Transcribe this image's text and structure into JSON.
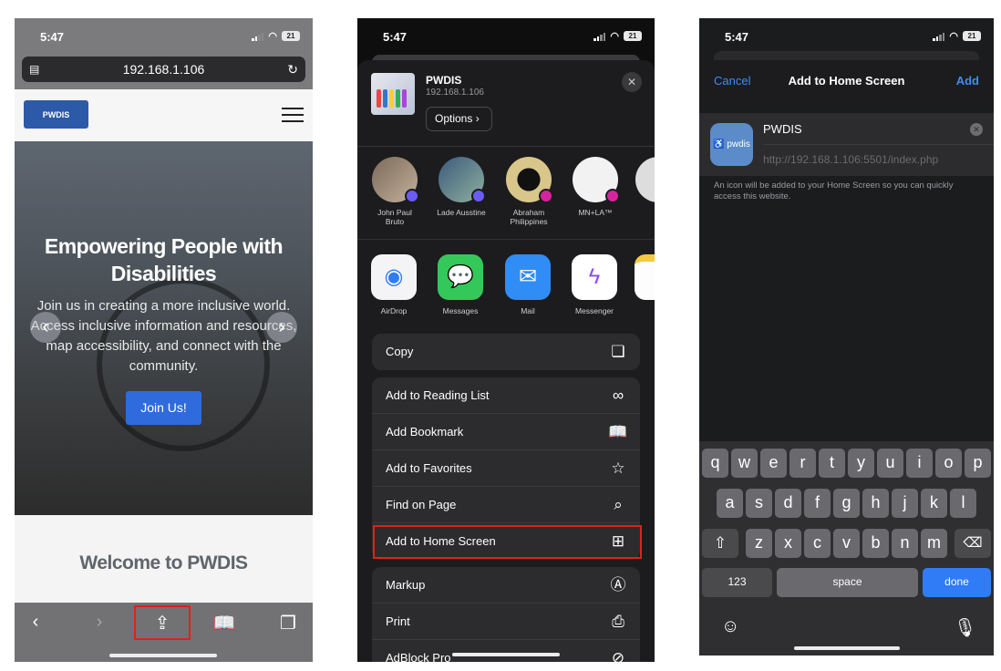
{
  "status": {
    "time": "5:47",
    "battery": "21"
  },
  "safari": {
    "url": "192.168.1.106",
    "logo_text": "PWDIS",
    "hero_title": "Empowering People with Disabilities",
    "hero_text": "Join us in creating a more inclusive world. Access inclusive information and resources, map accessibility, and connect with the community.",
    "join_label": "Join Us!",
    "welcome": "Welcome to PWDIS"
  },
  "share": {
    "site_name": "PWDIS",
    "site_url": "192.168.1.106",
    "options_label": "Options",
    "people": [
      {
        "name": "John Paul Bruto",
        "badge": "messenger"
      },
      {
        "name": "Lade Ausstine",
        "badge": "messenger"
      },
      {
        "name": "Abraham Philippines",
        "badge": "instagram"
      },
      {
        "name": "MN+LA™",
        "badge": "instagram"
      }
    ],
    "apps": [
      "AirDrop",
      "Messages",
      "Mail",
      "Messenger",
      "N"
    ],
    "actions_1": [
      {
        "label": "Copy",
        "icon": "copy-icon"
      }
    ],
    "actions_2": [
      {
        "label": "Add to Reading List",
        "icon": "glasses-icon"
      },
      {
        "label": "Add Bookmark",
        "icon": "book-icon"
      },
      {
        "label": "Add to Favorites",
        "icon": "star-icon"
      },
      {
        "label": "Find on Page",
        "icon": "find-icon"
      },
      {
        "label": "Add to Home Screen",
        "icon": "plus-square-icon"
      }
    ],
    "actions_3": [
      {
        "label": "Markup",
        "icon": "markup-icon"
      },
      {
        "label": "Print",
        "icon": "printer-icon"
      },
      {
        "label": "AdBlock Pro",
        "icon": "block-icon"
      }
    ]
  },
  "add_home": {
    "cancel": "Cancel",
    "title": "Add to Home Screen",
    "add": "Add",
    "icon_text": "pwdis",
    "name_value": "PWDIS",
    "url_value": "http://192.168.1.106:5501/index.php",
    "note": "An icon will be added to your Home Screen so you can quickly access this website.",
    "keyboard": {
      "row1": [
        "q",
        "w",
        "e",
        "r",
        "t",
        "y",
        "u",
        "i",
        "o",
        "p"
      ],
      "row2": [
        "a",
        "s",
        "d",
        "f",
        "g",
        "h",
        "j",
        "k",
        "l"
      ],
      "row3": [
        "z",
        "x",
        "c",
        "v",
        "b",
        "n",
        "m"
      ],
      "numbers": "123",
      "space": "space",
      "done": "done"
    }
  },
  "colors": {
    "accent_blue": "#3f8cf5",
    "highlight_red": "#e02020",
    "site_blue": "#2f6bdd"
  }
}
